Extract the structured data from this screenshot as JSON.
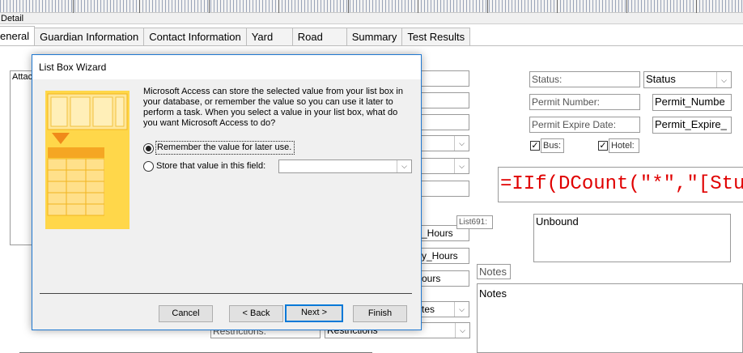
{
  "section": {
    "title": "Detail"
  },
  "tabs": [
    "eneral",
    "Guardian Information",
    "Contact Information",
    "Yard",
    "Road",
    "Summary",
    "Test Results"
  ],
  "form": {
    "list_left_text": "Attac",
    "status_label": "Status:",
    "status_value": "Status",
    "permit_number_label": "Permit Number:",
    "permit_number_value": "Permit_Numbe",
    "permit_expire_label": "Permit Expire Date:",
    "permit_expire_value": "Permit_Expire_",
    "bus_label": "Bus:",
    "hotel_label": "Hotel:",
    "iif_formula": "=IIf(DCount(\"*\",\"[Studer",
    "list_label": "List691:",
    "unbound_text": "Unbound",
    "notes_label": "Notes",
    "notes_value": "Notes",
    "hours_1": "_Hours",
    "hours_2": "y_Hours",
    "hours_3": "ours",
    "partial_4": "tes",
    "restrictions_label": "Restrictions:",
    "restrictions_value": "Restrictions"
  },
  "dialog": {
    "title": "List Box Wizard",
    "message": "Microsoft Access can store the selected value from your list box in your database, or remember the value so you can use it later to perform a task.  When you select a value in your list box, what do you want Microsoft Access to do?",
    "option_remember": "Remember the value for later use.",
    "option_store": "Store that value in this field:",
    "store_field_value": "",
    "buttons": {
      "cancel": "Cancel",
      "back": "< Back",
      "next": "Next >",
      "finish": "Finish"
    }
  },
  "colors": {
    "accent": "#0078d7",
    "formula": "#e00000",
    "wizard_art": "#ffd74a"
  }
}
